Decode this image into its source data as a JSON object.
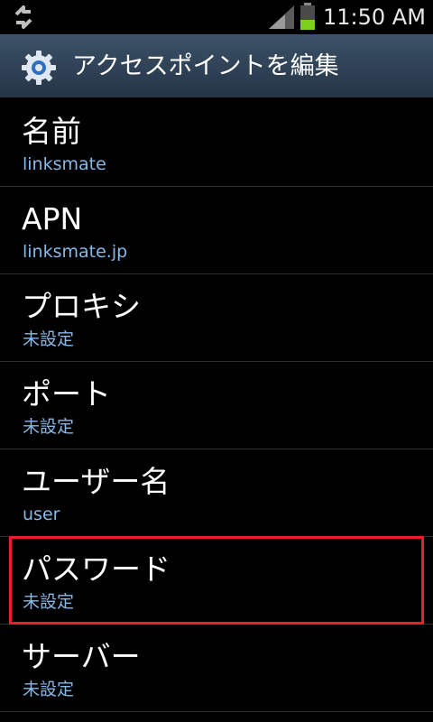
{
  "status_bar": {
    "time": "11:50 AM",
    "icons": [
      "sync-icon",
      "signal-icon",
      "battery-icon"
    ],
    "battery_color": "#7bd11c"
  },
  "header": {
    "title": "アクセスポイントを編集",
    "icon": "gear-icon"
  },
  "fields": [
    {
      "label": "名前",
      "value": "linksmate"
    },
    {
      "label": "APN",
      "value": "linksmate.jp"
    },
    {
      "label": "プロキシ",
      "value": "未設定"
    },
    {
      "label": "ポート",
      "value": "未設定"
    },
    {
      "label": "ユーザー名",
      "value": "user"
    },
    {
      "label": "パスワード",
      "value": "未設定"
    },
    {
      "label": "サーバー",
      "value": "未設定"
    }
  ],
  "colors": {
    "value_text": "#86b8e8",
    "highlight": "#e8202a",
    "header_bg": "#34485e"
  }
}
